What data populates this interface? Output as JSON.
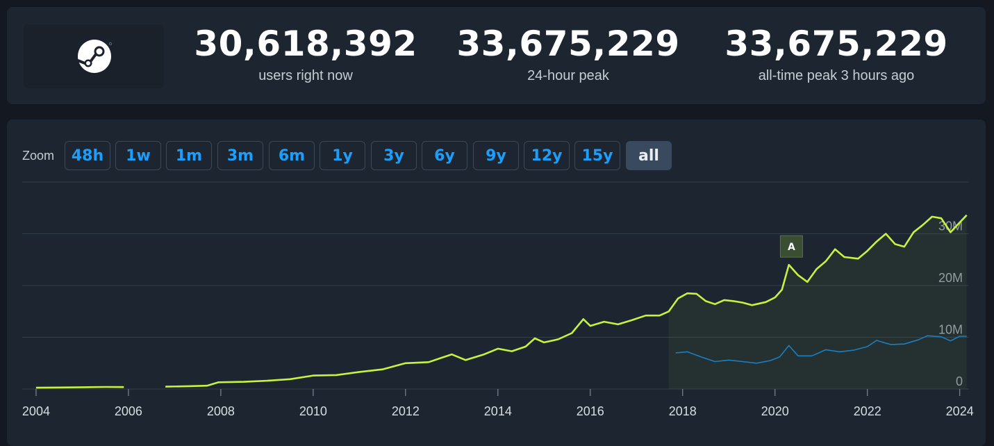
{
  "stats": [
    {
      "value": "30,618,392",
      "label": "users right now"
    },
    {
      "value": "33,675,229",
      "label": "24-hour peak"
    },
    {
      "value": "33,675,229",
      "label": "all-time peak 3 hours ago"
    }
  ],
  "icons": {
    "logo": "steam-logo-icon"
  },
  "zoom": {
    "label": "Zoom",
    "buttons": [
      "48h",
      "1w",
      "1m",
      "3m",
      "6m",
      "1y",
      "3y",
      "6y",
      "9y",
      "12y",
      "15y",
      "all"
    ],
    "active": "all"
  },
  "chart_data": {
    "type": "line",
    "title": "",
    "xlabel": "",
    "ylabel": "",
    "x_ticks": [
      "2004",
      "2006",
      "2008",
      "2010",
      "2012",
      "2014",
      "2016",
      "2018",
      "2020",
      "2022",
      "2024"
    ],
    "y_ticks": [
      "0",
      "10M",
      "20M",
      "30M"
    ],
    "ylim": [
      0,
      40000000
    ],
    "xlim": [
      2003.7,
      2024.2
    ],
    "grid": true,
    "colors": {
      "users": "#c7f33e",
      "in_game": "#1a7fc4",
      "grid": "#323e4b",
      "flag": "#3b4d33"
    },
    "annotations": [
      {
        "label": "A",
        "x": 2020.25,
        "y": 24000000
      }
    ],
    "series": [
      {
        "key": "users",
        "points": [
          [
            2004.0,
            250000
          ],
          [
            2004.5,
            300000
          ],
          [
            2005.0,
            350000
          ],
          [
            2005.5,
            400000
          ],
          [
            2005.9,
            380000
          ],
          [
            null,
            null
          ],
          [
            2006.8,
            450000
          ],
          [
            2007.3,
            550000
          ],
          [
            2007.7,
            650000
          ],
          [
            2007.95,
            1300000
          ],
          [
            2008.5,
            1400000
          ],
          [
            2009.0,
            1600000
          ],
          [
            2009.5,
            1900000
          ],
          [
            2010.0,
            2600000
          ],
          [
            2010.5,
            2700000
          ],
          [
            2011.0,
            3300000
          ],
          [
            2011.5,
            3800000
          ],
          [
            2012.0,
            5000000
          ],
          [
            2012.5,
            5200000
          ],
          [
            2013.0,
            6700000
          ],
          [
            2013.3,
            5600000
          ],
          [
            2013.7,
            6700000
          ],
          [
            2014.0,
            7800000
          ],
          [
            2014.3,
            7300000
          ],
          [
            2014.6,
            8200000
          ],
          [
            2014.8,
            9800000
          ],
          [
            2015.0,
            9000000
          ],
          [
            2015.3,
            9600000
          ],
          [
            2015.6,
            10800000
          ],
          [
            2015.85,
            13500000
          ],
          [
            2016.0,
            12200000
          ],
          [
            2016.3,
            13000000
          ],
          [
            2016.6,
            12500000
          ],
          [
            2016.9,
            13300000
          ],
          [
            2017.2,
            14200000
          ],
          [
            2017.5,
            14200000
          ],
          [
            2017.7,
            15000000
          ],
          [
            2017.9,
            17500000
          ],
          [
            2018.1,
            18500000
          ],
          [
            2018.3,
            18400000
          ],
          [
            2018.5,
            17000000
          ],
          [
            2018.7,
            16400000
          ],
          [
            2018.9,
            17200000
          ],
          [
            2019.1,
            17000000
          ],
          [
            2019.3,
            16700000
          ],
          [
            2019.5,
            16200000
          ],
          [
            2019.8,
            16800000
          ],
          [
            2020.0,
            17700000
          ],
          [
            2020.15,
            19200000
          ],
          [
            2020.3,
            24000000
          ],
          [
            2020.5,
            22000000
          ],
          [
            2020.7,
            20700000
          ],
          [
            2020.9,
            23200000
          ],
          [
            2021.1,
            24700000
          ],
          [
            2021.3,
            27000000
          ],
          [
            2021.5,
            25500000
          ],
          [
            2021.8,
            25200000
          ],
          [
            2022.0,
            26700000
          ],
          [
            2022.2,
            28500000
          ],
          [
            2022.4,
            30000000
          ],
          [
            2022.6,
            28000000
          ],
          [
            2022.8,
            27500000
          ],
          [
            2023.0,
            30300000
          ],
          [
            2023.2,
            31700000
          ],
          [
            2023.4,
            33300000
          ],
          [
            2023.6,
            33000000
          ],
          [
            2023.8,
            30300000
          ],
          [
            2024.0,
            32200000
          ],
          [
            2024.15,
            33600000
          ]
        ]
      },
      {
        "key": "in_game",
        "points": [
          [
            2017.85,
            7000000
          ],
          [
            2018.1,
            7200000
          ],
          [
            2018.4,
            6200000
          ],
          [
            2018.7,
            5300000
          ],
          [
            2019.0,
            5600000
          ],
          [
            2019.3,
            5300000
          ],
          [
            2019.6,
            5000000
          ],
          [
            2019.9,
            5500000
          ],
          [
            2020.1,
            6200000
          ],
          [
            2020.3,
            8400000
          ],
          [
            2020.5,
            6400000
          ],
          [
            2020.8,
            6400000
          ],
          [
            2021.1,
            7600000
          ],
          [
            2021.4,
            7200000
          ],
          [
            2021.7,
            7500000
          ],
          [
            2022.0,
            8200000
          ],
          [
            2022.2,
            9400000
          ],
          [
            2022.5,
            8600000
          ],
          [
            2022.8,
            8700000
          ],
          [
            2023.1,
            9500000
          ],
          [
            2023.3,
            10300000
          ],
          [
            2023.6,
            10100000
          ],
          [
            2023.8,
            9300000
          ],
          [
            2024.0,
            10200000
          ],
          [
            2024.15,
            10200000
          ]
        ]
      }
    ]
  }
}
